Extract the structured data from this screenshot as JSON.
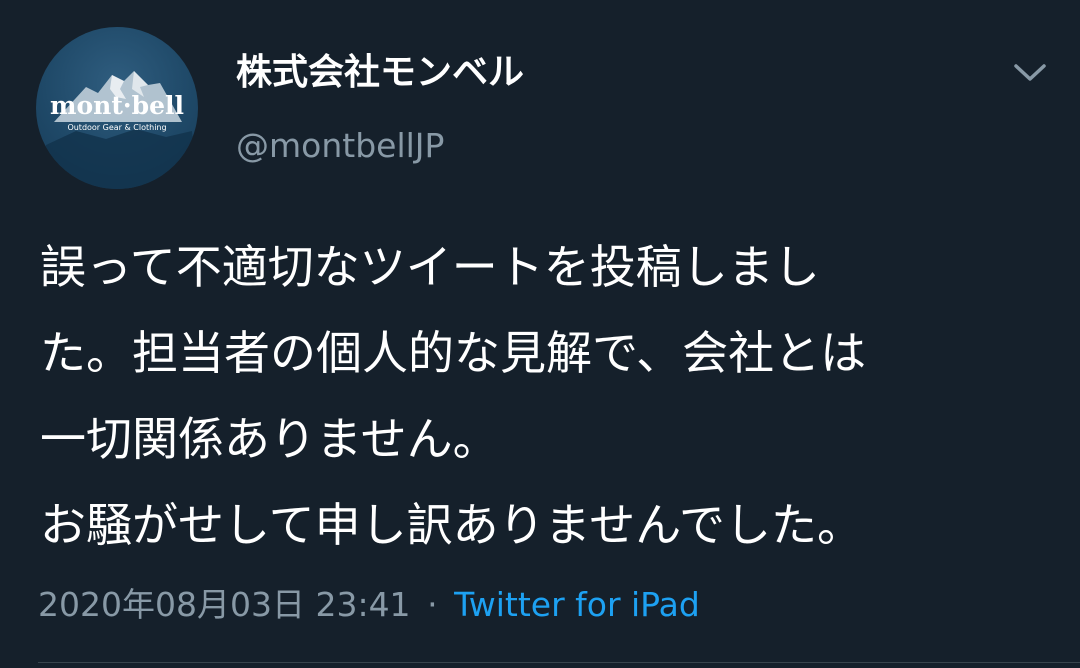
{
  "tweet": {
    "author": {
      "display_name": "株式会社モンベル",
      "handle": "@montbellJP",
      "avatar": {
        "logo_text": "mont·bell",
        "logo_subtext": "Outdoor Gear & Clothing"
      }
    },
    "menu_icon": "chevron-down-icon",
    "text_lines": [
      "誤って不適切なツイートを投稿しまし",
      "た。担当者の個人的な見解で、会社とは",
      "一切関係ありません。",
      "お騒がせして申し訳ありませんでした。"
    ],
    "timestamp": "2020年08月03日 23:41",
    "separator": "·",
    "source": "Twitter for iPad"
  },
  "colors": {
    "background": "#15202b",
    "text_primary": "#ffffff",
    "text_secondary": "#8899a6",
    "link": "#1da1f2",
    "divider": "#38444d"
  }
}
